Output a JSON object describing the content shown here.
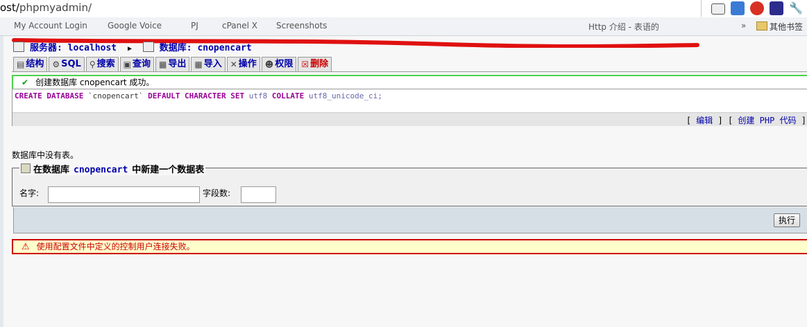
{
  "browser": {
    "url_prefix": "ost/",
    "url_path": "phpmyadmin/",
    "bookmarks": [
      {
        "label": "My Account Login"
      },
      {
        "label": "Google Voice"
      },
      {
        "label": "PJ"
      },
      {
        "label": "cPanel X"
      },
      {
        "label": "Screenshots"
      },
      {
        "label": "Http 介绍 - 表语的"
      }
    ],
    "more": "»",
    "other_bookmarks": "其他书签"
  },
  "breadcrumb": {
    "server_label": "服务器:",
    "server_value": "localhost",
    "db_label": "数据库:",
    "db_value": "cnopencart"
  },
  "tabs": [
    {
      "label": "结构",
      "icon": "structure-icon"
    },
    {
      "label": "SQL",
      "icon": "sql-icon"
    },
    {
      "label": "搜索",
      "icon": "search-icon"
    },
    {
      "label": "查询",
      "icon": "query-icon"
    },
    {
      "label": "导出",
      "icon": "export-icon"
    },
    {
      "label": "导入",
      "icon": "import-icon"
    },
    {
      "label": "操作",
      "icon": "operations-icon"
    },
    {
      "label": "权限",
      "icon": "privileges-icon"
    },
    {
      "label": "删除",
      "icon": "drop-icon"
    }
  ],
  "success_message": "创建数据库 cnopencart 成功。",
  "sql": {
    "kw1": "CREATE DATABASE",
    "ident": "`cnopencart`",
    "kw2": "DEFAULT CHARACTER SET",
    "charset": "utf8",
    "kw3": "COLLATE",
    "collation": "utf8_unicode_ci;"
  },
  "sql_links": {
    "edit": "编辑",
    "create_php": "创建 PHP 代码"
  },
  "no_tables": "数据库中没有表。",
  "new_table": {
    "legend_prefix": "在数据库",
    "legend_db": "cnopencart",
    "legend_suffix": "中新建一个数据表",
    "name_label": "名字:",
    "name_value": "",
    "fields_label": "字段数:",
    "fields_value": "",
    "go_label": "执行"
  },
  "error_message": "使用配置文件中定义的控制用户连接失败。",
  "colors": {
    "success_border": "#4cd14c",
    "error_border": "#cc0000",
    "link": "#0000aa"
  }
}
